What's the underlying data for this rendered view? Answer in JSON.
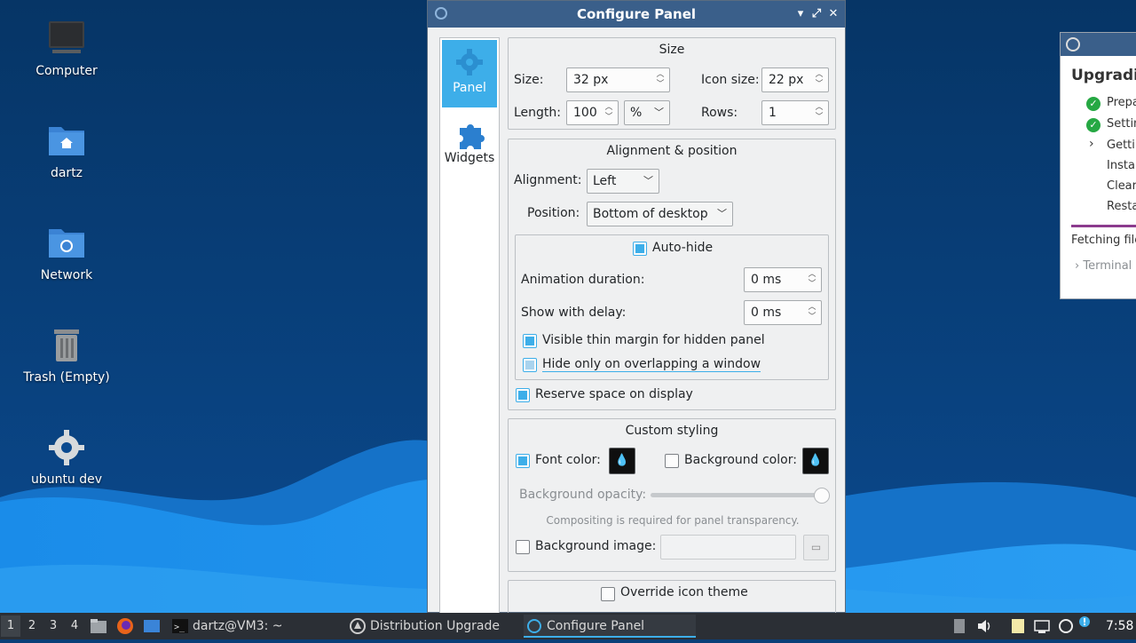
{
  "desktop": {
    "icons": [
      {
        "label": "Computer",
        "icon": "computer-icon"
      },
      {
        "label": "dartz",
        "icon": "home-folder-icon"
      },
      {
        "label": "Network",
        "icon": "network-folder-icon"
      },
      {
        "label": "Trash (Empty)",
        "icon": "trash-icon"
      },
      {
        "label": "ubuntu dev",
        "icon": "gear-icon"
      }
    ]
  },
  "configure_panel": {
    "title": "Configure Panel",
    "sidebar": [
      {
        "label": "Panel",
        "icon": "gear-icon",
        "active": true
      },
      {
        "label": "Widgets",
        "icon": "puzzle-icon",
        "active": false
      }
    ],
    "size_group": {
      "title": "Size",
      "size_label": "Size:",
      "size_value": "32 px",
      "icon_size_label": "Icon size:",
      "icon_size_value": "22 px",
      "length_label": "Length:",
      "length_value": "100",
      "length_unit": "%",
      "rows_label": "Rows:",
      "rows_value": "1"
    },
    "alignment_group": {
      "title": "Alignment & position",
      "alignment_label": "Alignment:",
      "alignment_value": "Left",
      "position_label": "Position:",
      "position_value": "Bottom of desktop",
      "autohide_label": "Auto-hide",
      "autohide_checked": true,
      "animation_label": "Animation duration:",
      "animation_value": "0 ms",
      "delay_label": "Show with delay:",
      "delay_value": "0 ms",
      "thin_margin_label": "Visible thin margin for hidden panel",
      "thin_margin_checked": true,
      "overlap_label": "Hide only on overlapping a window",
      "overlap_checked": false,
      "reserve_label": "Reserve space on display",
      "reserve_checked": true
    },
    "styling_group": {
      "title": "Custom styling",
      "font_color_label": "Font color:",
      "font_color_checked": true,
      "bg_color_label": "Background color:",
      "bg_color_checked": false,
      "opacity_label": "Background opacity:",
      "opacity_level": 1.0,
      "compositing_note": "Compositing is required for panel transparency.",
      "bg_image_label": "Background image:",
      "bg_image_value": "",
      "bg_image_checked": false
    },
    "icon_theme_group": {
      "override_label": "Override icon theme",
      "override_checked": false
    }
  },
  "upgrade_window": {
    "heading": "Upgradi",
    "steps": [
      {
        "label": "Prepa",
        "status": "done"
      },
      {
        "label": "Settin",
        "status": "done"
      },
      {
        "label": "Getti",
        "status": "current"
      },
      {
        "label": "Insta",
        "status": "pending"
      },
      {
        "label": "Clear",
        "status": "pending"
      },
      {
        "label": "Resta",
        "status": "pending"
      }
    ],
    "status_text": "Fetching file",
    "terminal_label": "Terminal"
  },
  "taskbar": {
    "workspaces": [
      "1",
      "2",
      "3",
      "4"
    ],
    "active_workspace": "1",
    "tasks": [
      {
        "label": "dartz@VM3: ~",
        "icon": "terminal-icon",
        "active": false
      },
      {
        "label": "Distribution Upgrade",
        "icon": "upgrade-icon",
        "active": false
      },
      {
        "label": "Configure Panel",
        "icon": "panel-icon",
        "active": true
      }
    ],
    "clock": "7:58"
  },
  "colors": {
    "accent": "#3daee9",
    "titlebar": "#3a5f8a",
    "taskbar": "#2b2f35",
    "desktop_top": "#0a3f78",
    "wave": "#1f8ee8"
  }
}
